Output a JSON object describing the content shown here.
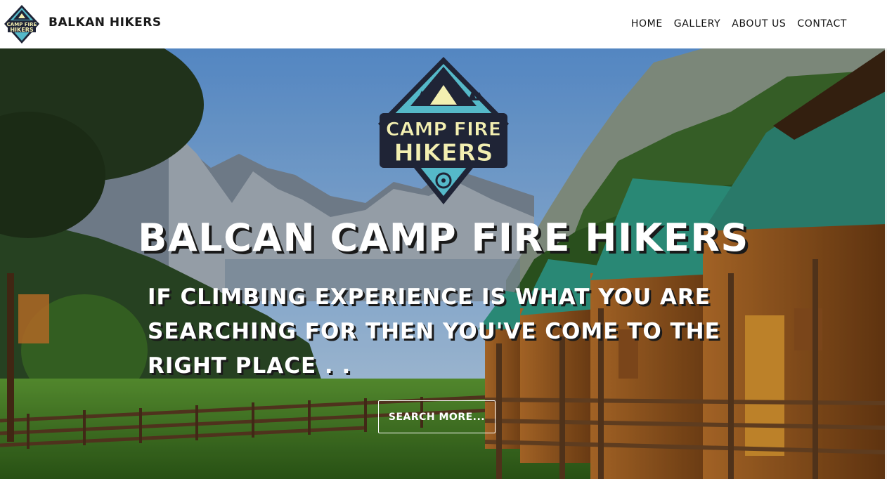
{
  "brand": {
    "name": "BALKAN HIKERS",
    "logo_text_top": "CAMP FIRE",
    "logo_text_bottom": "HIKERS"
  },
  "nav": {
    "items": [
      {
        "label": "HOME"
      },
      {
        "label": "GALLERY"
      },
      {
        "label": "ABOUT US"
      },
      {
        "label": "CONTACT"
      }
    ]
  },
  "hero": {
    "logo_text_top": "CAMP FIRE",
    "logo_text_bottom": "HIKERS",
    "title": "BALCAN CAMP FIRE HIKERS",
    "subtitle_lines": [
      "IF CLIMBING EXPERIENCE IS WHAT YOU ARE",
      "SEARCHING FOR THEN YOU'VE COME TO THE",
      "RIGHT PLACE . ."
    ],
    "button_label": "SEARCH MORE..."
  },
  "colors": {
    "logo_navy": "#1f2436",
    "logo_teal": "#55b9c9",
    "logo_cream": "#f3efb1",
    "roof_teal": "#2f9b86",
    "cabin_wood": "#c9822f",
    "sky": "#6fa5e0",
    "grass": "#4e8f2c"
  }
}
